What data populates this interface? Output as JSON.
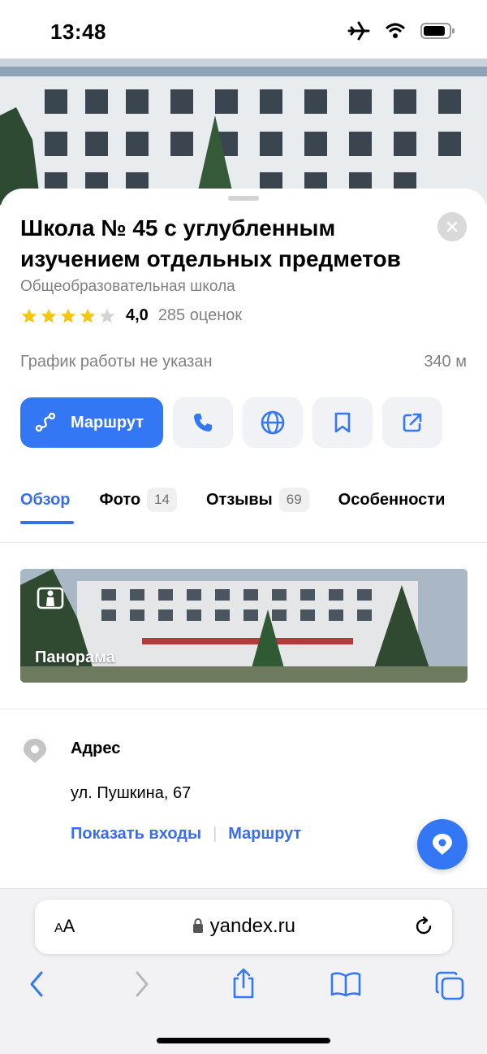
{
  "status_bar": {
    "time": "13:48"
  },
  "place": {
    "title": "Школа № 45 с углубленным изучением отдельных предметов",
    "category": "Общеобразовательная школа",
    "rating": "4,0",
    "stars_filled": 4,
    "stars_total": 5,
    "ratings_count": "285 оценок",
    "hours": "График работы не указан",
    "distance": "340 м"
  },
  "actions": {
    "route_label": "Маршрут"
  },
  "tabs": [
    {
      "label": "Обзор",
      "badge": ""
    },
    {
      "label": "Фото",
      "badge": "14"
    },
    {
      "label": "Отзывы",
      "badge": "69"
    },
    {
      "label": "Особенности",
      "badge": ""
    }
  ],
  "panorama": {
    "label": "Панорама"
  },
  "address": {
    "heading": "Адрес",
    "value": "ул. Пушкина, 67",
    "show_entrances": "Показать входы",
    "route": "Маршрут"
  },
  "browser": {
    "text_size": "AA",
    "host": "yandex.ru"
  },
  "colors": {
    "accent": "#3477f5",
    "link": "#3a6ee8",
    "star": "#f5c518"
  }
}
